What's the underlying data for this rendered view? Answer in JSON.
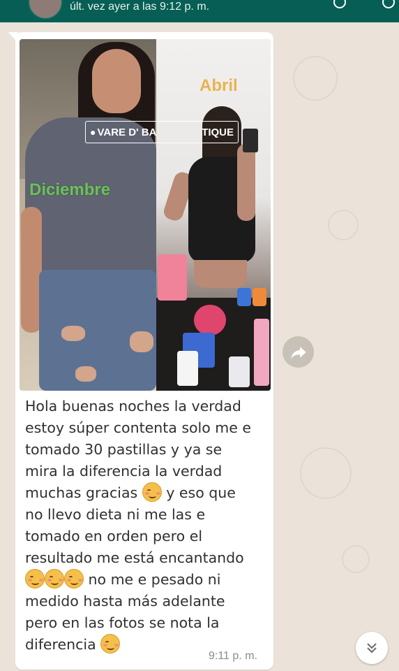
{
  "header": {
    "last_seen": "últ. vez ayer a las 9:12 p. m."
  },
  "message": {
    "photo": {
      "label_left": "Diciembre",
      "label_right": "Abril",
      "location_part1": "VARE D' BA",
      "location_part2": "TIQUE"
    },
    "lines": [
      "Hola buenas noches la verdad",
      "estoy súper contenta solo me e",
      "tomado 30 pastillas y ya se",
      "mira la diferencia la verdad",
      "muchas gracias",
      "y eso que",
      "no llevo dieta ni me las e",
      "tomado en orden pero el",
      "resultado me está encantando",
      "no me e pesado ni",
      "medido hasta más adelante",
      "pero en las fotos se nota la",
      "diferencia"
    ],
    "emoji_icon": "smiling-face-with-blush-icon",
    "time": "9:11 p. m."
  },
  "controls": {
    "forward_icon": "forward-arrow-icon",
    "scroll_icon": "double-chevron-down-icon"
  },
  "colors": {
    "header": "#075e54",
    "bubble": "#ffffff",
    "background": "#ece5dd",
    "label_left": "#6cbf5f",
    "label_right": "#e9b34e"
  }
}
